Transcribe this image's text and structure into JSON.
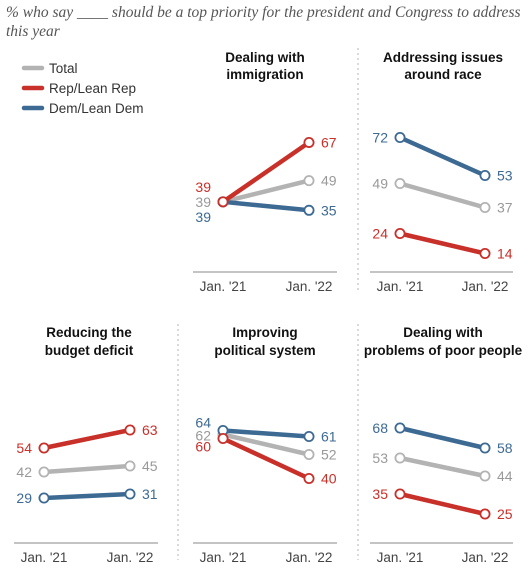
{
  "subtitle": "% who say ____ should be a top priority for the president and Congress to address this year",
  "colors": {
    "Total": "#b3b3b3",
    "Rep/Lean Rep": "#c8302a",
    "Dem/Lean Dem": "#3d6a93",
    "Total_text": "#999999",
    "axis": "#888888",
    "separator": "#b5b5b5"
  },
  "chart_data": {
    "type": "line",
    "x": [
      "Jan. '21",
      "Jan. '22"
    ],
    "legend": {
      "position": "top-left",
      "items": [
        "Total",
        "Rep/Lean Rep",
        "Dem/Lean Dem"
      ]
    },
    "panels": [
      {
        "title": [
          "Dealing with",
          "immigration"
        ],
        "series": [
          {
            "name": "Total",
            "values": [
              39,
              49
            ]
          },
          {
            "name": "Rep/Lean Rep",
            "values": [
              39,
              67
            ]
          },
          {
            "name": "Dem/Lean Dem",
            "values": [
              39,
              35
            ]
          }
        ]
      },
      {
        "title": [
          "Addressing issues",
          "around race"
        ],
        "series": [
          {
            "name": "Total",
            "values": [
              49,
              37
            ]
          },
          {
            "name": "Rep/Lean Rep",
            "values": [
              24,
              14
            ]
          },
          {
            "name": "Dem/Lean Dem",
            "values": [
              72,
              53
            ]
          }
        ]
      },
      {
        "title": [
          "Reducing the",
          "budget deficit"
        ],
        "series": [
          {
            "name": "Total",
            "values": [
              42,
              45
            ]
          },
          {
            "name": "Rep/Lean Rep",
            "values": [
              54,
              63
            ]
          },
          {
            "name": "Dem/Lean Dem",
            "values": [
              29,
              31
            ]
          }
        ]
      },
      {
        "title": [
          "Improving",
          "political system"
        ],
        "series": [
          {
            "name": "Total",
            "values": [
              62,
              52
            ]
          },
          {
            "name": "Rep/Lean Rep",
            "values": [
              60,
              40
            ]
          },
          {
            "name": "Dem/Lean Dem",
            "values": [
              64,
              61
            ]
          }
        ]
      },
      {
        "title": [
          "Dealing with",
          "problems of poor people"
        ],
        "series": [
          {
            "name": "Total",
            "values": [
              53,
              44
            ]
          },
          {
            "name": "Rep/Lean Rep",
            "values": [
              35,
              25
            ]
          },
          {
            "name": "Dem/Lean Dem",
            "values": [
              68,
              58
            ]
          }
        ]
      }
    ]
  }
}
